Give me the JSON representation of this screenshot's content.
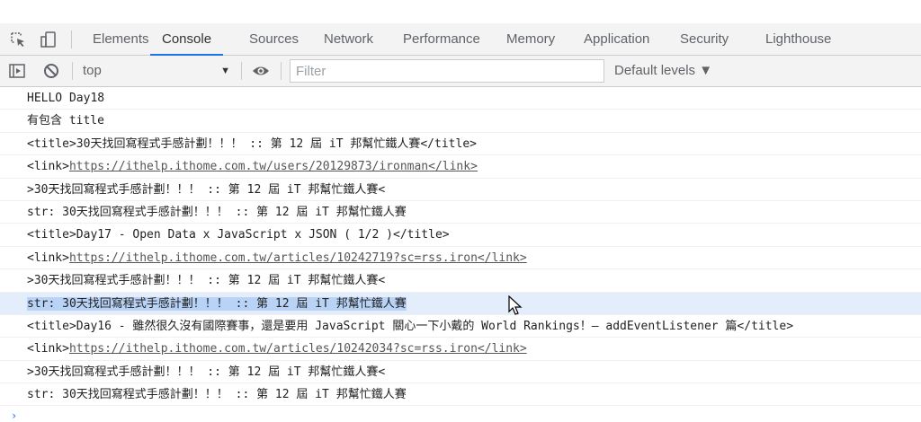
{
  "tabs": [
    {
      "label": "Elements"
    },
    {
      "label": "Console",
      "active": true
    },
    {
      "label": "Sources"
    },
    {
      "label": "Network"
    },
    {
      "label": "Performance"
    },
    {
      "label": "Memory"
    },
    {
      "label": "Application"
    },
    {
      "label": "Security"
    },
    {
      "label": "Lighthouse"
    }
  ],
  "toolbar": {
    "context": "top",
    "filter_placeholder": "Filter",
    "levels": "Default levels ▼"
  },
  "colors": {
    "accent": "#1a73e8",
    "selected_row": "#e3edfb",
    "selected_text": "#b9d3f6"
  },
  "logs": [
    {
      "parts": [
        {
          "text": "HELLO Day18"
        }
      ]
    },
    {
      "parts": [
        {
          "text": "有包含 title"
        }
      ]
    },
    {
      "parts": [
        {
          "text": "<title>30天找回寫程式手感計劃！！！ :: 第 12 屆 iT 邦幫忙鐵人賽</title>"
        }
      ]
    },
    {
      "parts": [
        {
          "text": "<link>"
        },
        {
          "text": "https://ithelp.ithome.com.tw/users/20129873/ironman</link>",
          "link": true
        }
      ]
    },
    {
      "parts": [
        {
          "text": ">30天找回寫程式手感計劃！！！ :: 第 12 屆 iT 邦幫忙鐵人賽<"
        }
      ]
    },
    {
      "parts": [
        {
          "text": "str: 30天找回寫程式手感計劃！！！ :: 第 12 屆 iT 邦幫忙鐵人賽"
        }
      ]
    },
    {
      "parts": [
        {
          "text": "<title>Day17 - Open Data x JavaScript x JSON ( 1/2 )</title>"
        }
      ]
    },
    {
      "parts": [
        {
          "text": "<link>"
        },
        {
          "text": "https://ithelp.ithome.com.tw/articles/10242719?sc=rss.iron</link>",
          "link": true
        }
      ]
    },
    {
      "parts": [
        {
          "text": ">30天找回寫程式手感計劃！！！ :: 第 12 屆 iT 邦幫忙鐵人賽<"
        }
      ]
    },
    {
      "parts": [
        {
          "text": "str: 30天找回寫程式手感計劃！！！ :: 第 12 屆 iT 邦幫忙鐵人賽"
        }
      ],
      "selected": true
    },
    {
      "parts": [
        {
          "text": "<title>Day16 - 雖然很久沒有國際賽事，還是要用 JavaScript 關心一下小戴的 World Rankings！— addEventListener 篇</title>"
        }
      ]
    },
    {
      "parts": [
        {
          "text": "<link>"
        },
        {
          "text": "https://ithelp.ithome.com.tw/articles/10242034?sc=rss.iron</link>",
          "link": true
        }
      ]
    },
    {
      "parts": [
        {
          "text": ">30天找回寫程式手感計劃！！！ :: 第 12 屆 iT 邦幫忙鐵人賽<"
        }
      ]
    },
    {
      "parts": [
        {
          "text": "str: 30天找回寫程式手感計劃！！！ :: 第 12 屆 iT 邦幫忙鐵人賽"
        }
      ]
    }
  ]
}
